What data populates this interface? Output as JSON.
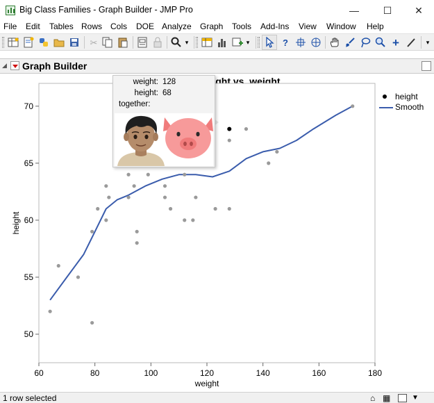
{
  "window": {
    "title": "Big Class Families - Graph Builder - JMP Pro",
    "minimize_glyph": "—",
    "maximize_glyph": "☐",
    "close_glyph": "✕"
  },
  "menu": [
    "File",
    "Edit",
    "Tables",
    "Rows",
    "Cols",
    "DOE",
    "Analyze",
    "Graph",
    "Tools",
    "Add-Ins",
    "View",
    "Window",
    "Help"
  ],
  "toolbar": {
    "icons": [
      "new-table-icon",
      "new-script-icon",
      "python-icon",
      "open-icon",
      "save-icon",
      "cut-icon",
      "copy-icon",
      "paste-icon",
      "journal-icon",
      "lock-icon",
      "search-icon",
      "data-table-icon",
      "distribution-icon",
      "add-rows-icon",
      "arrow-icon",
      "help-icon",
      "crosshair-icon",
      "target-icon",
      "hand-icon",
      "brush-icon",
      "lasso-icon",
      "magnifier-icon",
      "plus-icon",
      "line-icon",
      "overflow-icon"
    ]
  },
  "graph_builder": {
    "title": "Graph Builder"
  },
  "chart_data": {
    "type": "scatter",
    "title": "height vs. weight",
    "xlabel": "weight",
    "ylabel": "height",
    "xlim": [
      60,
      180
    ],
    "ylim": [
      47.5,
      72
    ],
    "xticks": [
      60,
      80,
      100,
      120,
      140,
      160,
      180
    ],
    "yticks": [
      50,
      55,
      60,
      65,
      70
    ],
    "series": [
      {
        "name": "height",
        "points": [
          [
            64,
            52
          ],
          [
            67,
            56
          ],
          [
            74,
            55
          ],
          [
            79,
            51
          ],
          [
            79,
            59
          ],
          [
            81,
            61
          ],
          [
            84,
            60
          ],
          [
            84,
            63
          ],
          [
            85,
            62
          ],
          [
            92,
            62
          ],
          [
            92,
            64
          ],
          [
            94,
            63
          ],
          [
            95,
            58
          ],
          [
            95,
            59
          ],
          [
            99,
            64
          ],
          [
            105,
            62
          ],
          [
            105,
            63
          ],
          [
            107,
            61
          ],
          [
            112,
            60
          ],
          [
            112,
            64
          ],
          [
            115,
            60
          ],
          [
            116,
            62
          ],
          [
            123,
            61
          ],
          [
            128,
            61
          ],
          [
            128,
            67
          ],
          [
            128,
            68
          ],
          [
            134,
            68
          ],
          [
            142,
            65
          ],
          [
            145,
            66
          ],
          [
            172,
            70
          ]
        ]
      },
      {
        "name": "Smooth",
        "points": [
          [
            64,
            53
          ],
          [
            70,
            55
          ],
          [
            76,
            57
          ],
          [
            80,
            59
          ],
          [
            84,
            61
          ],
          [
            88,
            61.8
          ],
          [
            92,
            62.2
          ],
          [
            98,
            63
          ],
          [
            104,
            63.6
          ],
          [
            110,
            64
          ],
          [
            116,
            64
          ],
          [
            122,
            63.8
          ],
          [
            128,
            64.3
          ],
          [
            134,
            65.4
          ],
          [
            140,
            66
          ],
          [
            146,
            66.3
          ],
          [
            152,
            67
          ],
          [
            158,
            68
          ],
          [
            166,
            69.2
          ],
          [
            172,
            70
          ]
        ]
      }
    ],
    "selected_point": [
      128,
      68
    ],
    "colors": {
      "points": "#9a9a9a",
      "selected": "#000000",
      "smooth": "#3a5cac"
    }
  },
  "legend": [
    "height",
    "Smooth"
  ],
  "tooltip": {
    "weight_label": "weight:",
    "weight_value": "128",
    "height_label": "height:",
    "height_value": "68",
    "together_label": "together:",
    "images": [
      "boy-face-image",
      "pig-face-image"
    ]
  },
  "status": {
    "text": "1 row selected"
  }
}
